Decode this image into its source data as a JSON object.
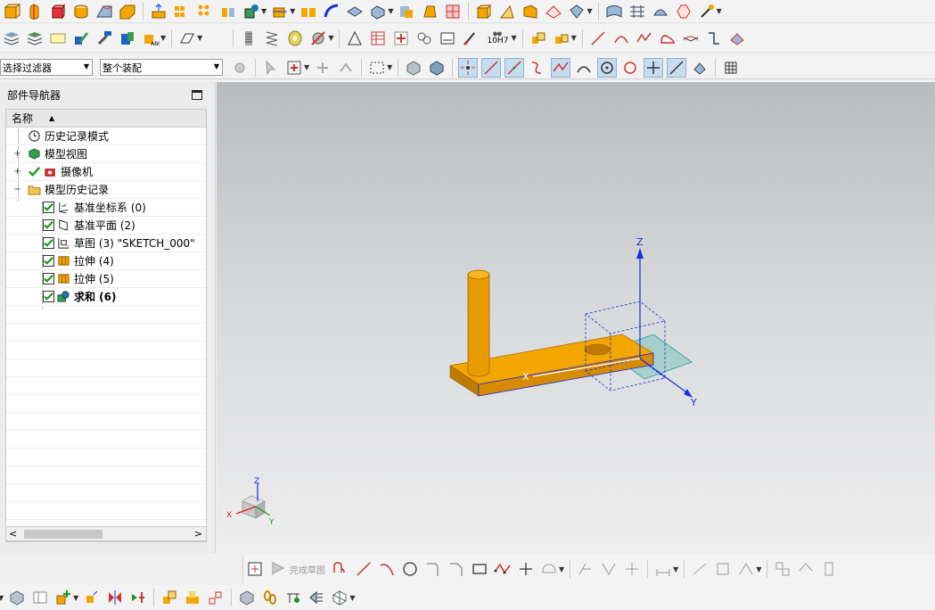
{
  "toolbar": {
    "selection_filter": "选择过滤器",
    "assembly_scope": "整个装配",
    "tolerance_label": "10H7"
  },
  "navigator": {
    "title": "部件导航器",
    "column_name": "名称",
    "items": [
      {
        "label": "历史记录模式",
        "icon": "clock-icon",
        "bold": false
      },
      {
        "label": "模型视图",
        "icon": "model-view-icon",
        "bold": false
      },
      {
        "label": "摄像机",
        "icon": "camera-icon",
        "bold": false
      },
      {
        "label": "模型历史记录",
        "icon": "folder-icon",
        "bold": false
      },
      {
        "label": "基准坐标系 (0)",
        "icon": "datum-csys-icon",
        "bold": false
      },
      {
        "label": "基准平面 (2)",
        "icon": "datum-plane-icon",
        "bold": false
      },
      {
        "label": "草图 (3) \"SKETCH_000\"",
        "icon": "sketch-icon",
        "bold": false
      },
      {
        "label": "拉伸 (4)",
        "icon": "extrude-icon",
        "bold": false
      },
      {
        "label": "拉伸 (5)",
        "icon": "extrude-icon",
        "bold": false
      },
      {
        "label": "求和 (6)",
        "icon": "unite-icon",
        "bold": true
      }
    ]
  },
  "viewport": {
    "axis_x": "X",
    "axis_y": "Y",
    "axis_z": "Z",
    "triad_x": "X",
    "triad_y": "Y",
    "triad_z": "Z"
  },
  "sketch_toolbar": {
    "finish_sketch": "完成草图"
  },
  "colors": {
    "part_orange": "#f3a600",
    "part_dark": "#c07a00",
    "csys_blue": "#1a2ce0",
    "plane_cyan": "#3fa7a0",
    "accent_green": "#1a9a1a"
  }
}
